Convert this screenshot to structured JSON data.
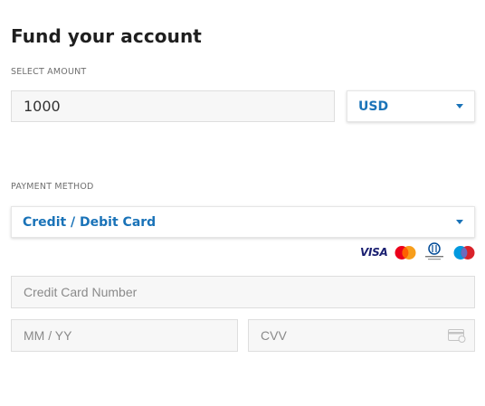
{
  "page": {
    "title": "Fund your account"
  },
  "amount": {
    "label": "SELECT AMOUNT",
    "value": "1000",
    "currency": "USD"
  },
  "payment": {
    "label": "PAYMENT METHOD",
    "method": "Credit / Debit Card",
    "card_logos": [
      "VISA",
      "Mastercard",
      "Diners Club International",
      "Maestro"
    ]
  },
  "card_form": {
    "number_placeholder": "Credit Card Number",
    "expiry_placeholder": "MM / YY",
    "cvv_placeholder": "CVV"
  },
  "colors": {
    "accent": "#1a73b8",
    "field_bg": "#f7f7f7",
    "field_border": "#dedede"
  },
  "icons": {
    "dropdown": "chevron-down-icon",
    "cvv": "card-cvv-icon"
  }
}
